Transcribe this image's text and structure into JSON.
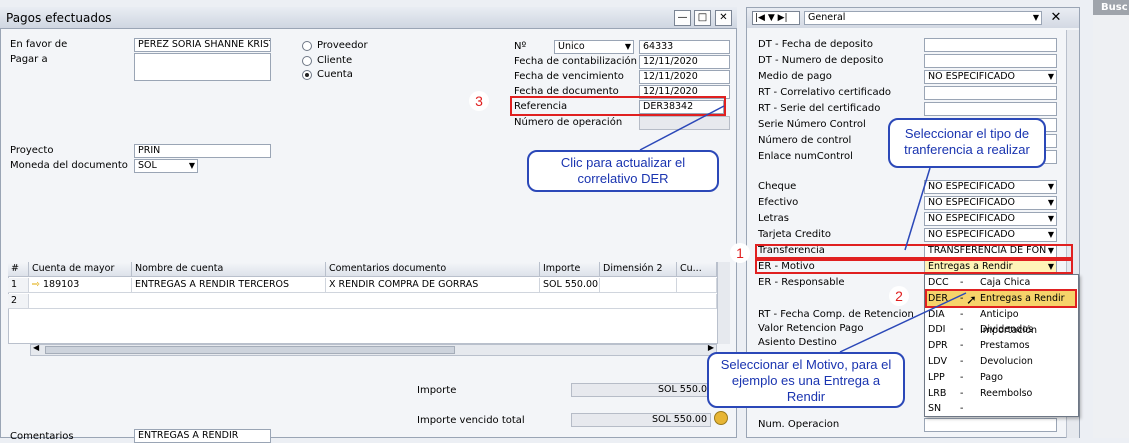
{
  "window": {
    "title": "Pagos efectuados",
    "minimize": "—",
    "maximize": "□",
    "close": "✕"
  },
  "form": {
    "en_favor_de_label": "En favor de",
    "en_favor_de_value": "PEREZ SORIA SHANNE KRIST",
    "pagar_a_label": "Pagar a",
    "radio_proveedor": "Proveedor",
    "radio_cliente": "Cliente",
    "radio_cuenta": "Cuenta",
    "proyecto_label": "Proyecto",
    "proyecto_value": "PRIN",
    "moneda_label": "Moneda del documento",
    "moneda_value": "SOL",
    "no_label": "Nº",
    "no_series": "Unico",
    "no_value": "64333",
    "fecha_cont_label": "Fecha de contabilización",
    "fecha_cont_value": "12/11/2020",
    "fecha_venc_label": "Fecha de vencimiento",
    "fecha_venc_value": "12/11/2020",
    "fecha_doc_label": "Fecha de documento",
    "fecha_doc_value": "12/11/2020",
    "referencia_label": "Referencia",
    "referencia_value": "DER38342",
    "num_operacion_label": "Número de operación"
  },
  "table": {
    "headers": [
      "#",
      "Cuenta de mayor",
      "Nombre de cuenta",
      "Comentarios documento",
      "Importe",
      "Dimensión 2",
      "Cu..."
    ],
    "rows": [
      {
        "n": "1",
        "cuenta": "189103",
        "nombre": "ENTREGAS A RENDIR TERCEROS",
        "comentarios": "X RENDIR COMPRA DE GORRAS",
        "importe": "SOL 550.00"
      },
      {
        "n": "2"
      }
    ]
  },
  "totals": {
    "importe_label": "Importe",
    "importe_value": "SOL 550.0",
    "vencido_label": "Importe vencido total",
    "vencido_value": "SOL 550.00",
    "comentarios_label": "Comentarios",
    "comentarios_value": "ENTREGAS A RENDIR"
  },
  "side": {
    "header_value": "General",
    "fields": [
      {
        "label": "DT - Fecha de deposito",
        "value": ""
      },
      {
        "label": "DT - Numero de deposito",
        "value": ""
      },
      {
        "label": "Medio de pago",
        "value": "NO ESPECIFICADO"
      },
      {
        "label": "RT - Correlativo certificado",
        "value": ""
      },
      {
        "label": "RT - Serie del certificado",
        "value": ""
      },
      {
        "label": "Serie Número Control",
        "value": ""
      },
      {
        "label": "Número de control",
        "value": ""
      },
      {
        "label": "Enlace numControl",
        "value": ""
      },
      {
        "label": "Cheque",
        "value": "NO ESPECIFICADO"
      },
      {
        "label": "Efectivo",
        "value": "NO ESPECIFICADO"
      },
      {
        "label": "Letras",
        "value": "NO ESPECIFICADO"
      },
      {
        "label": "Tarjeta Credito",
        "value": "NO ESPECIFICADO"
      },
      {
        "label": "Transferencia",
        "value": "TRANSFERENCIA DE FON"
      },
      {
        "label": "ER - Motivo",
        "value": "Entregas a Rendir"
      },
      {
        "label": "ER - Responsable",
        "value": ""
      },
      {
        "label": "RT - Fecha Comp. de Retencion",
        "value": ""
      },
      {
        "label": "Valor Retencion Pago",
        "value": ""
      },
      {
        "label": "Asiento Destino",
        "value": ""
      },
      {
        "label": "Num. Operacion",
        "value": ""
      }
    ],
    "dropdown": [
      {
        "code": "DCC",
        "sep": "-",
        "name": "Caja Chica"
      },
      {
        "code": "DER",
        "sep": "-",
        "name": "Entregas a Rendir"
      },
      {
        "code": "DIA",
        "sep": "-",
        "name": "Anticipo Importación"
      },
      {
        "code": "DDI",
        "sep": "-",
        "name": "Dividendos"
      },
      {
        "code": "DPR",
        "sep": "-",
        "name": "Prestamos"
      },
      {
        "code": "LDV",
        "sep": "-",
        "name": "Devolucion"
      },
      {
        "code": "LPP",
        "sep": "-",
        "name": "Pago"
      },
      {
        "code": "LRB",
        "sep": "-",
        "name": "Reembolso"
      },
      {
        "code": "SN",
        "sep": "-",
        "name": ""
      }
    ]
  },
  "annotations": {
    "callout_der": "Clic para actualizar el correlativo DER",
    "callout_tipo": "Seleccionar el tipo de tranferencia a realizar",
    "callout_motivo": "Seleccionar el Motivo, para el ejemplo es una Entrega a Rendir",
    "n1": "1",
    "n2": "2",
    "n3": "3"
  },
  "corner_label": "Busc"
}
